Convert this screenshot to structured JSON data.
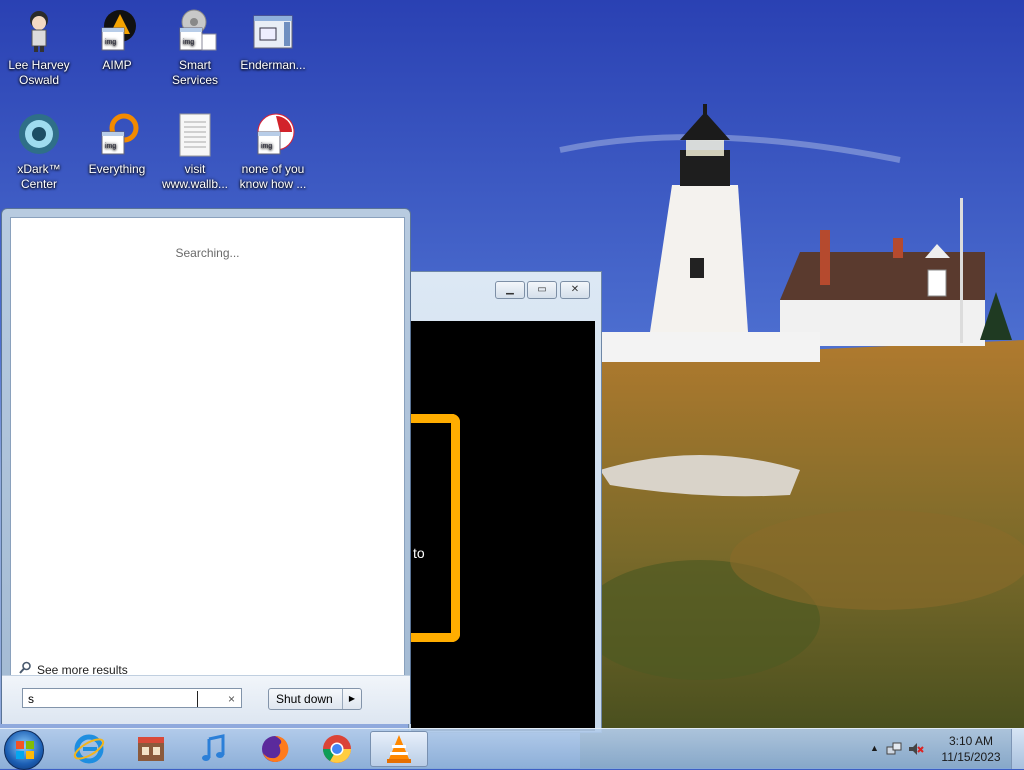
{
  "desktop": {
    "icons": [
      {
        "label": "Lee Harvey\nOswald"
      },
      {
        "label": "AIMP"
      },
      {
        "label": "Smart\nServices"
      },
      {
        "label": "Enderman..."
      },
      {
        "label": "xDark™\nCenter"
      },
      {
        "label": "Everything"
      },
      {
        "label": "visit\nwww.wallb..."
      },
      {
        "label": "none of you\nknow how ..."
      }
    ]
  },
  "background_window": {
    "fragment_text": "to",
    "minimize_glyph": "▁",
    "maximize_glyph": "▭",
    "close_glyph": "✕"
  },
  "start_menu": {
    "status_text": "Searching...",
    "see_more_label": "See more results",
    "search": {
      "value": "s",
      "clear_glyph": "×"
    },
    "shutdown_label": "Shut down",
    "shutdown_arrow": "▶"
  },
  "taskbar": {
    "pinned": [
      {
        "icon": "internet-explorer-icon"
      },
      {
        "icon": "store-icon"
      },
      {
        "icon": "itunes-icon"
      },
      {
        "icon": "firefox-icon"
      },
      {
        "icon": "chrome-icon"
      },
      {
        "icon": "vlc-icon",
        "active": true
      }
    ],
    "tray": {
      "time": "3:10 AM",
      "date": "11/15/2023",
      "overflow_glyph": "▲"
    }
  },
  "colors": {
    "vlc_orange": "#ffad00",
    "sky_top": "#2f49b8",
    "taskbar": "#a9c3e2"
  }
}
